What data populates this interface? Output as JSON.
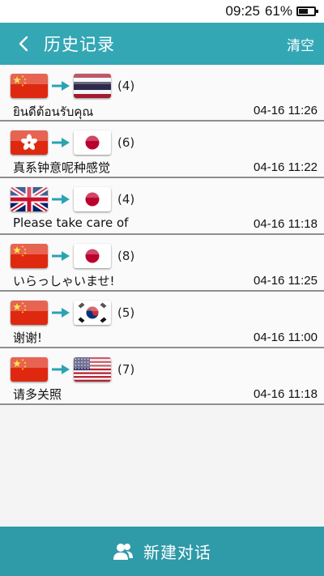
{
  "status_bar": {
    "time": "09:25",
    "battery": "61%",
    "battery_level": 0.61
  },
  "header": {
    "title": "历史记录",
    "clear_label": "清空"
  },
  "colors": {
    "accent": "#34a7b5",
    "bottom_bar": "#2f9aa8"
  },
  "history": [
    {
      "from_flag": "china-flag",
      "to_flag": "thailand-flag",
      "count": "(4)",
      "text": "ยินดีต้อนรับคุณ",
      "time": "04-16 11:26"
    },
    {
      "from_flag": "hong-kong-flag",
      "to_flag": "japan-flag",
      "count": "(6)",
      "text": "真系钟意呢种感觉",
      "time": "04-16 11:22"
    },
    {
      "from_flag": "uk-flag",
      "to_flag": "japan-flag",
      "count": "(4)",
      "text": "Please take care of",
      "time": "04-16 11:18"
    },
    {
      "from_flag": "china-flag",
      "to_flag": "japan-flag",
      "count": "(8)",
      "text": "いらっしゃいませ!",
      "time": "04-16 11:25"
    },
    {
      "from_flag": "china-flag",
      "to_flag": "south-korea-flag",
      "count": "(5)",
      "text": "谢谢!",
      "time": "04-16 11:00"
    },
    {
      "from_flag": "china-flag",
      "to_flag": "usa-flag",
      "count": "(7)",
      "text": "请多关照",
      "time": "04-16 11:18"
    }
  ],
  "bottom_bar": {
    "label": "新建对话",
    "icon": "users-icon"
  }
}
